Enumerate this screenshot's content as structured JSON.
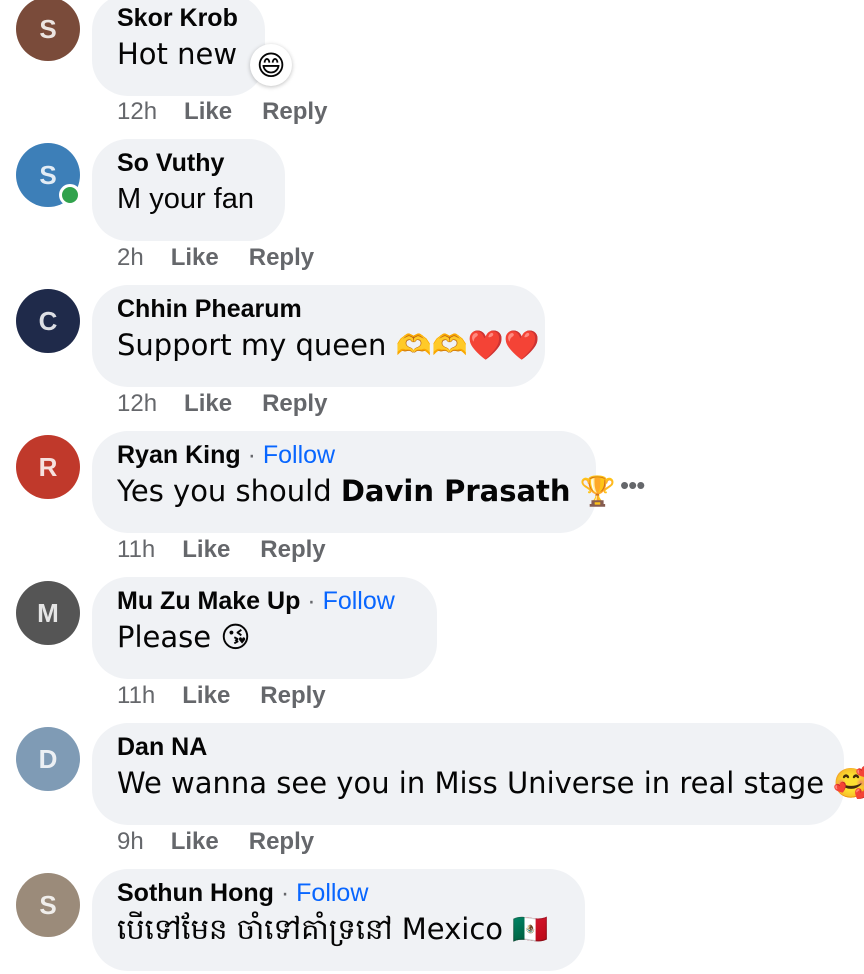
{
  "comments": [
    {
      "name": "Skor Krob",
      "follow": null,
      "text": "Hot new",
      "time": "12h",
      "like": "Like",
      "reply": "Reply",
      "avatar_color": "#7a4b3a",
      "avatar_initial": "S"
    },
    {
      "name": "So Vuthy",
      "follow": null,
      "text": "M your fan",
      "time": "2h",
      "like": "Like",
      "reply": "Reply",
      "avatar_color": "#3d7fb8",
      "avatar_initial": "S",
      "online": true
    },
    {
      "name": "Chhin Phearum",
      "follow": null,
      "text": "Support my queen 🫶🫶❤️❤️",
      "time": "12h",
      "like": "Like",
      "reply": "Reply",
      "avatar_color": "#1f2a4a",
      "avatar_initial": "C"
    },
    {
      "name": "Ryan King",
      "follow": "Follow",
      "text_prefix": "Yes you should ",
      "text_bold": "Davin Prasath",
      "text_suffix": " 🏆",
      "time": "11h",
      "like": "Like",
      "reply": "Reply",
      "avatar_color": "#c0392b",
      "avatar_initial": "R"
    },
    {
      "name": "Mu Zu Make Up",
      "follow": "Follow",
      "text": "Please 😘",
      "time": "11h",
      "like": "Like",
      "reply": "Reply",
      "avatar_color": "#555555",
      "avatar_initial": "M"
    },
    {
      "name": "Dan NA",
      "follow": null,
      "text": "We wanna see you in Miss Universe in real stage 🥰",
      "time": "9h",
      "like": "Like",
      "reply": "Reply",
      "avatar_color": "#7f9bb5",
      "avatar_initial": "D"
    },
    {
      "name": "Sothun Hong",
      "follow": "Follow",
      "text": "បើទៅមែន ចាំទៅគាំទ្រនៅ Mexico 🇲🇽",
      "avatar_color": "#9b8b7a",
      "avatar_initial": "S"
    }
  ],
  "reaction_emoji": "😄",
  "more_icon": "•••",
  "separator": "·",
  "colors": {
    "bubble": "#f0f2f5",
    "follow": "#0866ff",
    "meta": "#65676b",
    "online": "#31a24c"
  }
}
